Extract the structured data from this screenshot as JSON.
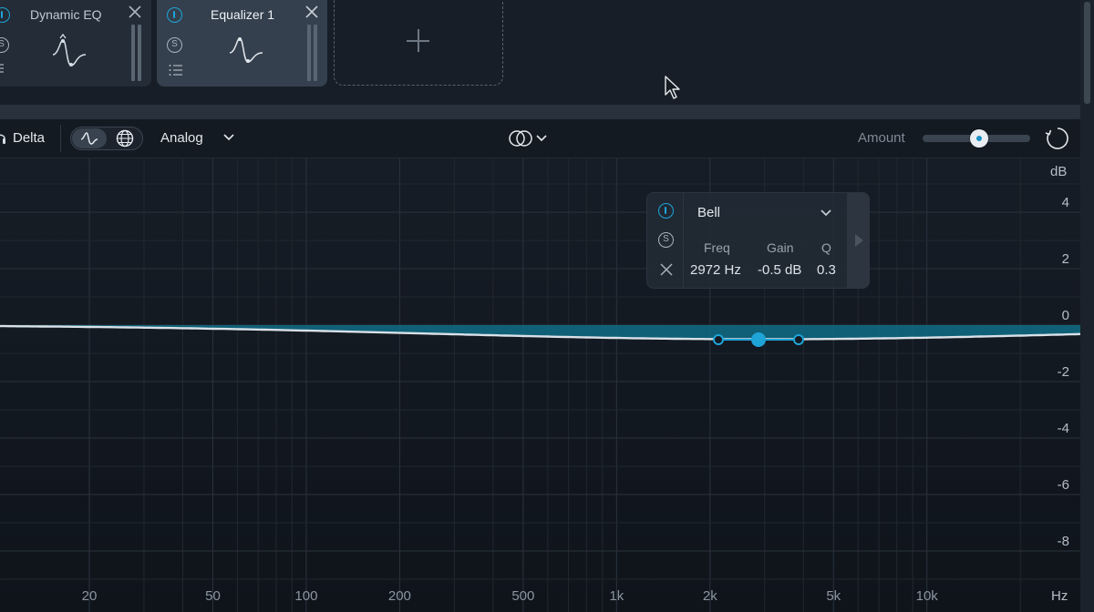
{
  "modules": [
    {
      "title": "Dynamic EQ",
      "active": false
    },
    {
      "title": "Equalizer 1",
      "active": true
    }
  ],
  "module_buttons": {
    "solo_label": "S"
  },
  "toolbar": {
    "delta_label": "Delta",
    "mode_label": "Analog",
    "amount_label": "Amount",
    "amount_value": 0.5
  },
  "band_popup": {
    "shape": "Bell",
    "solo_label": "S",
    "freq_header": "Freq",
    "gain_header": "Gain",
    "q_header": "Q",
    "freq_value": "2972 Hz",
    "gain_value": "-0.5 dB",
    "q_value": "0.3"
  },
  "graph": {
    "db_unit": "dB",
    "db_ticks": [
      "4",
      "2",
      "0",
      "-2",
      "-4",
      "-6",
      "-8"
    ],
    "hz_unit": "Hz",
    "freq_ticks": [
      "20",
      "50",
      "100",
      "200",
      "500",
      "1k",
      "2k",
      "5k",
      "10k"
    ]
  },
  "colors": {
    "accent": "#1fa4d8",
    "curve": "#d9e1e8",
    "fill": "#0f6d86",
    "background": "#141a22"
  }
}
